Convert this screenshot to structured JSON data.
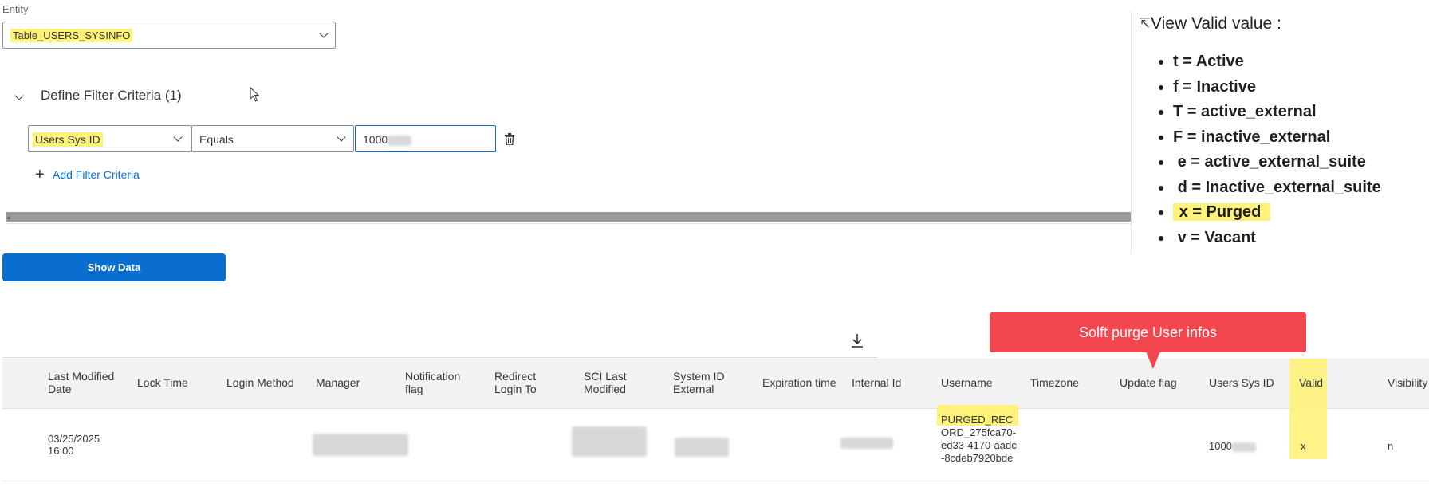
{
  "entity": {
    "label": "Entity",
    "value": "Table_USERS_SYSINFO"
  },
  "filter": {
    "header": "Define Filter Criteria (1)",
    "field": "Users Sys ID",
    "operator": "Equals",
    "value_prefix": "1000",
    "add_label": "Add Filter Criteria"
  },
  "show_data_label": "Show Data",
  "info_panel": {
    "title": "View  Valid value :",
    "items": [
      "t = Active",
      "f = Inactive",
      "T = active_external",
      "F = inactive_external",
      "e = active_external_suite",
      "d = Inactive_external_suite",
      "x = Purged",
      "v = Vacant"
    ],
    "highlighted_index": 6
  },
  "callout": "Solft purge User infos",
  "table": {
    "columns": [
      "Last Modified Date",
      "Lock Time",
      "Login Method",
      "Manager",
      "Notification flag",
      "Redirect Login To",
      "SCI Last Modified",
      "System ID External",
      "Expiration time",
      "Internal Id",
      "Username",
      "Timezone",
      "Update flag",
      "Users Sys ID",
      "Valid",
      "Visibility"
    ],
    "row": {
      "last_modified": "03/25/2025 16:00",
      "username_hl": "PURGED_REC",
      "username_rest": "ORD_275fca70-ed33-4170-aadc-8cdeb7920bde",
      "users_sys_id_prefix": "1000",
      "valid": "x",
      "visibility": "n"
    }
  },
  "colors": {
    "accent": "#0a6ed1",
    "highlight": "#fff27a",
    "callout": "#f2474e"
  }
}
